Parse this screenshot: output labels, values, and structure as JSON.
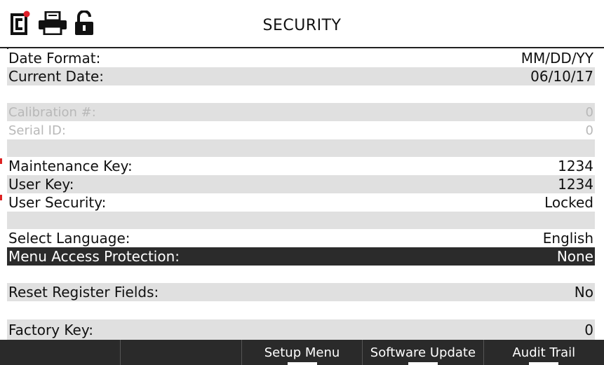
{
  "header": {
    "title": "SECURITY",
    "icons": [
      "lc-logo-icon",
      "printer-icon",
      "unlocked-padlock-icon"
    ]
  },
  "rows": [
    {
      "label": "Date Format:",
      "value": "MM/DD/YY"
    },
    {
      "label": "Current Date:",
      "value": "06/10/17"
    },
    {
      "label": "",
      "value": ""
    },
    {
      "label": "Calibration #:",
      "value": "0"
    },
    {
      "label": "Serial ID:",
      "value": "0"
    },
    {
      "label": "",
      "value": ""
    },
    {
      "label": "Maintenance Key:",
      "value": "1234"
    },
    {
      "label": "User Key:",
      "value": "1234"
    },
    {
      "label": "User Security:",
      "value": "Locked"
    },
    {
      "label": "",
      "value": ""
    },
    {
      "label": "Select Language:",
      "value": "English"
    },
    {
      "label": "Menu Access Protection:",
      "value": "None"
    },
    {
      "label": "",
      "value": ""
    },
    {
      "label": "Reset Register Fields:",
      "value": "No"
    },
    {
      "label": "",
      "value": ""
    },
    {
      "label": "Factory Key:",
      "value": "0"
    }
  ],
  "softkeys": [
    "",
    "",
    "Setup Menu",
    "Software Update",
    "Audit Trail"
  ],
  "colors": {
    "selected_row": "#2b2b2b",
    "alt_row": "#e0e0e0",
    "disabled_text": "#b8b8b8",
    "bottom_bar": "#2a2a2a",
    "logo_dot": "#e0202a"
  }
}
